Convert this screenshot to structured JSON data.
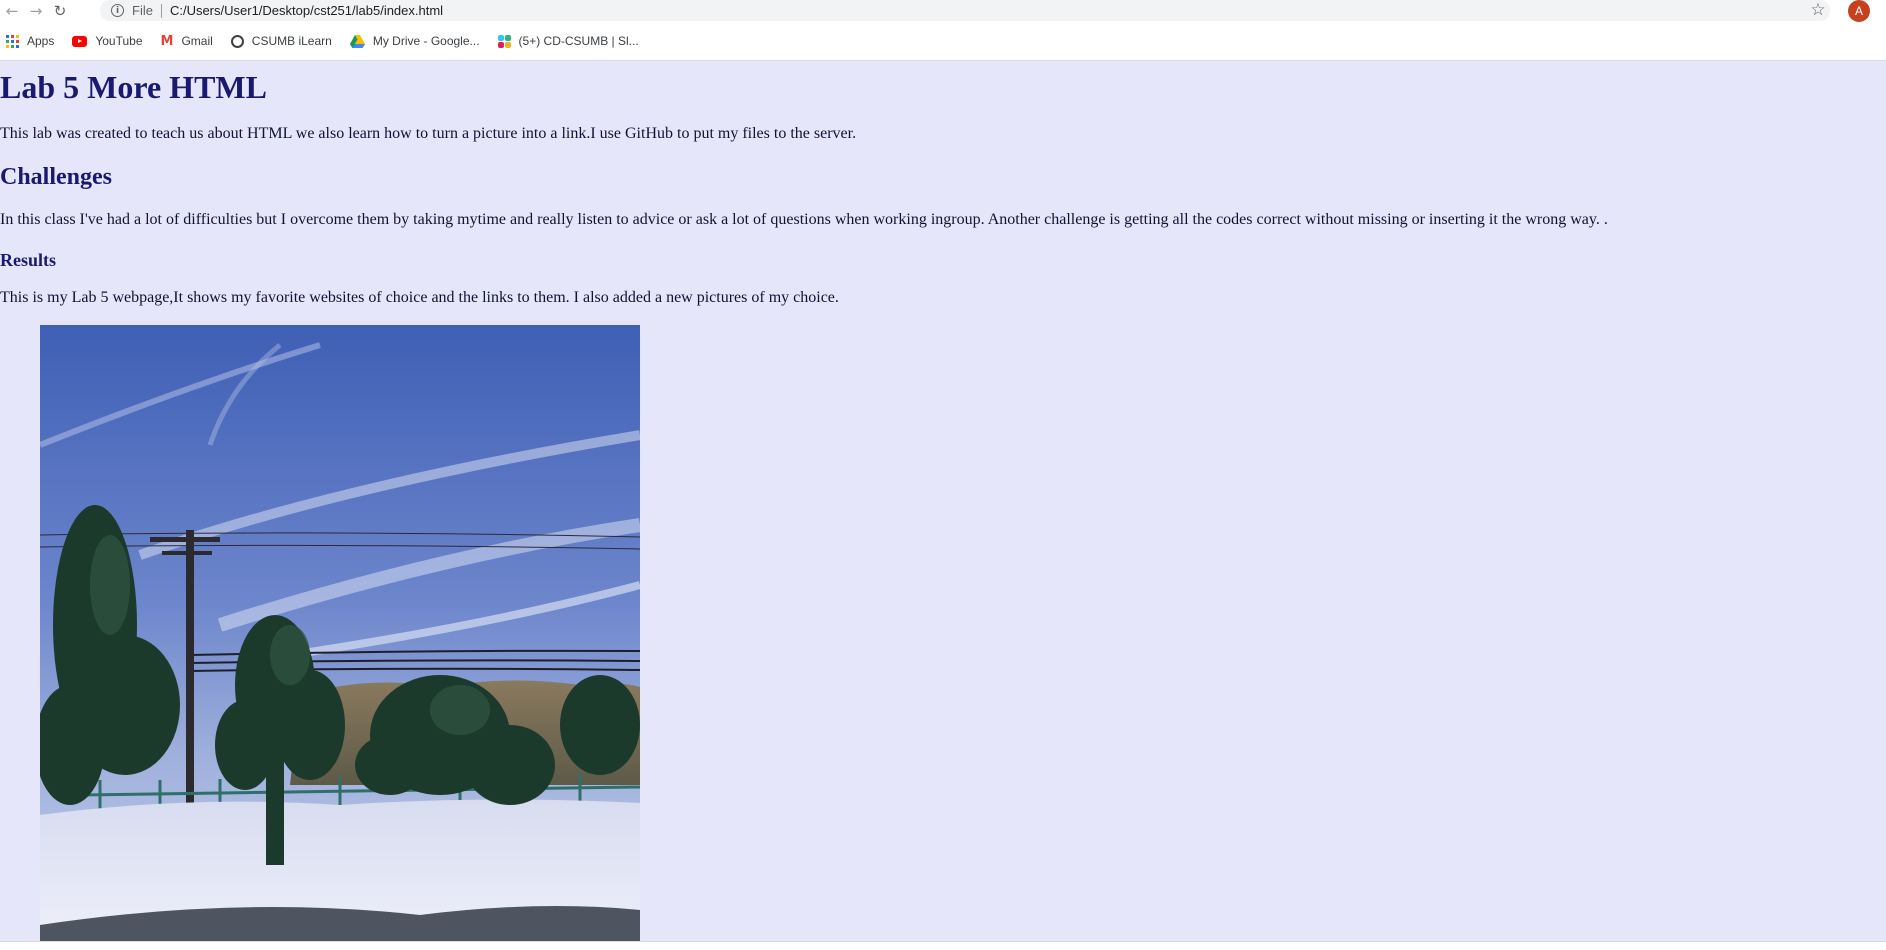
{
  "browser": {
    "scheme_label": "File",
    "url": "C:/Users/User1/Desktop/cst251/lab5/index.html",
    "profile_initial": "A",
    "bookmarks": [
      {
        "label": "Apps",
        "icon": "apps-grid-icon"
      },
      {
        "label": "YouTube",
        "icon": "youtube-icon"
      },
      {
        "label": "Gmail",
        "icon": "gmail-icon"
      },
      {
        "label": "CSUMB iLearn",
        "icon": "ilearn-icon"
      },
      {
        "label": "My Drive - Google...",
        "icon": "google-drive-icon"
      },
      {
        "label": "(5+) CD-CSUMB | Sl...",
        "icon": "slack-icon"
      }
    ]
  },
  "page": {
    "background": "#e6e6fa",
    "heading_color": "#191970",
    "title": "Lab 5 More HTML",
    "intro": "This lab was created to teach us about HTML we also learn how to turn a picture into a link.I use GitHub to put my files to the server.",
    "challenges_heading": "Challenges",
    "challenges_text": "In this class I've had a lot of difficulties but I overcome them by taking mytime and really listen to advice or ask a lot of questions when working ingroup. Another challenge is getting all the codes correct without missing or inserting it the wrong way. .",
    "results_heading": "Results",
    "results_text": "This is my Lab 5 webpage,It shows my favorite websites of choice and the links to them. I also added a new pictures of my choice.",
    "photo_subject": "desert landscape with Joshua trees, snow, power pole and blue sky"
  }
}
